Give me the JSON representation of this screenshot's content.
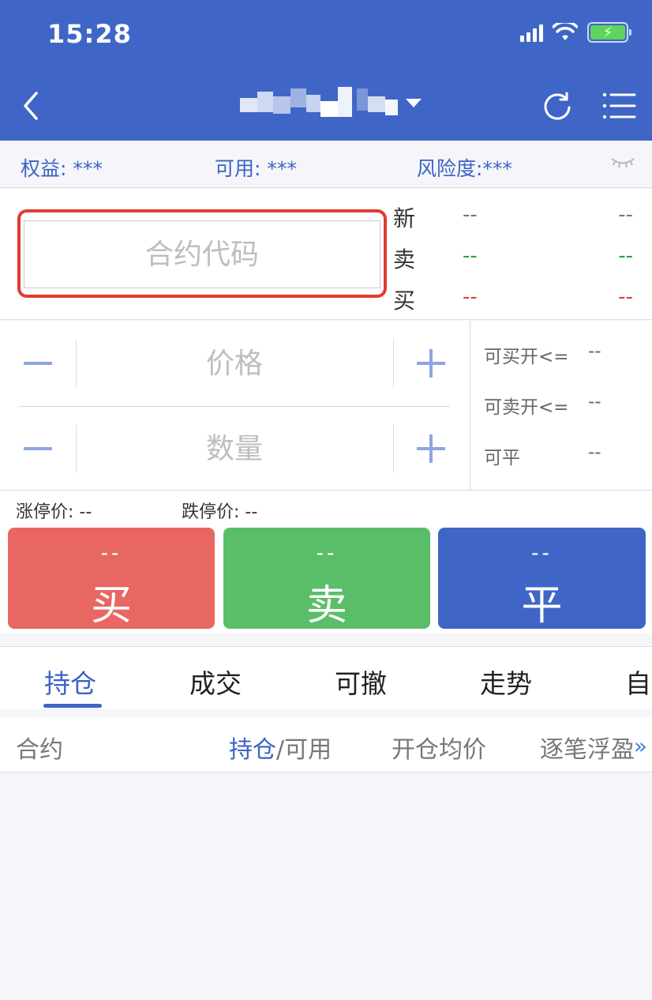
{
  "status_bar": {
    "time": "15:28"
  },
  "header": {
    "title": ""
  },
  "account": {
    "equity": "权益: ***",
    "available": "可用: ***",
    "risk": "风险度:***"
  },
  "contract": {
    "placeholder": "合约代码",
    "quotes": [
      {
        "label": "新",
        "v1": "--",
        "v2": "--",
        "color": "#777777"
      },
      {
        "label": "卖",
        "v1": "--",
        "v2": "--",
        "color": "#2e9e3a"
      },
      {
        "label": "买",
        "v1": "--",
        "v2": "--",
        "color": "#e23b2b"
      }
    ]
  },
  "order": {
    "price_placeholder": "价格",
    "qty_placeholder": "数量",
    "minus": "−",
    "plus": "+",
    "avail": [
      {
        "label": "可买开<=",
        "value": "--"
      },
      {
        "label": "可卖开<=",
        "value": "--"
      },
      {
        "label": "可平",
        "value": "--"
      }
    ]
  },
  "limits": {
    "up": "涨停价:  --",
    "down": "跌停价:  --"
  },
  "trade": {
    "buy": {
      "price": "--",
      "label": "买"
    },
    "sell": {
      "price": "--",
      "label": "卖"
    },
    "close": {
      "price": "--",
      "label": "平"
    }
  },
  "tabs": [
    "持仓",
    "成交",
    "可撤",
    "走势",
    "自"
  ],
  "table": {
    "col1": "合约",
    "col2_active": "持仓",
    "col2_sep": "/可用",
    "col3": "开仓均价",
    "col4": "逐笔浮盈"
  },
  "colors": {
    "brand": "#3f66c7",
    "buy": "#e86763",
    "sell": "#5abe68",
    "highlight": "#e23b2b"
  }
}
